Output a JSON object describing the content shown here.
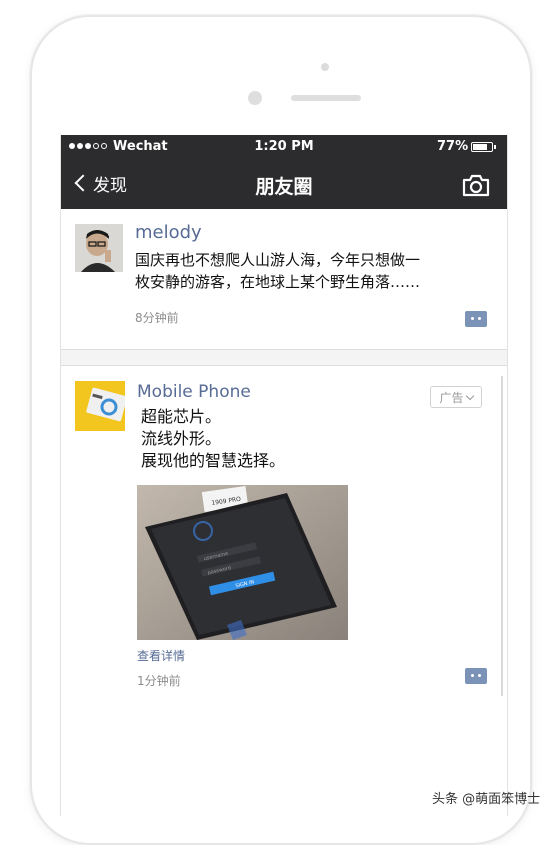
{
  "status_bar": {
    "carrier": "Wechat",
    "time": "1:20 PM",
    "battery": "77%",
    "battery_level": 0.77
  },
  "nav": {
    "back_label": "发现",
    "title": "朋友圈",
    "camera_icon": "camera-icon",
    "back_icon": "chevron-left-icon"
  },
  "posts": [
    {
      "author": "melody",
      "text_lines": [
        "国庆再也不想爬人山游人海，今年只想做一",
        "枚安静的游客，在地球上某个野生角落……"
      ],
      "time": "8分钟前"
    },
    {
      "author": "Mobile Phone",
      "ad_label": "广告",
      "text_lines": [
        "超能芯片。",
        "流线外形。",
        "展现他的智慧选择。"
      ],
      "link": "查看详情",
      "time": "1分钟前",
      "image_labels": {
        "box_label": "1909 PRO",
        "username": "username",
        "password": "password",
        "signin": "SIGN IN"
      }
    }
  ],
  "watermark": "头条 @萌面笨博士",
  "colors": {
    "header_bg": "#2c2c2e",
    "link_blue": "#576b95",
    "comment_btn": "#7a93b6",
    "page_bg": "#f4f4f4"
  }
}
